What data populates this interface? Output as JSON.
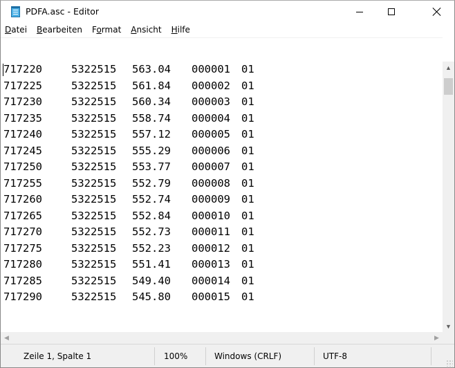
{
  "window": {
    "title": "PDFA.asc - Editor"
  },
  "menu": [
    "Datei",
    "Bearbeiten",
    "Format",
    "Ansicht",
    "Hilfe"
  ],
  "menu_mnemonics": [
    "D",
    "B",
    "o",
    "A",
    "H"
  ],
  "document": {
    "lines": [
      [
        "717220",
        "5322515",
        "563.04",
        "000001",
        "01"
      ],
      [
        "717225",
        "5322515",
        "561.84",
        "000002",
        "01"
      ],
      [
        "717230",
        "5322515",
        "560.34",
        "000003",
        "01"
      ],
      [
        "717235",
        "5322515",
        "558.74",
        "000004",
        "01"
      ],
      [
        "717240",
        "5322515",
        "557.12",
        "000005",
        "01"
      ],
      [
        "717245",
        "5322515",
        "555.29",
        "000006",
        "01"
      ],
      [
        "717250",
        "5322515",
        "553.77",
        "000007",
        "01"
      ],
      [
        "717255",
        "5322515",
        "552.79",
        "000008",
        "01"
      ],
      [
        "717260",
        "5322515",
        "552.74",
        "000009",
        "01"
      ],
      [
        "717265",
        "5322515",
        "552.84",
        "000010",
        "01"
      ],
      [
        "717270",
        "5322515",
        "552.73",
        "000011",
        "01"
      ],
      [
        "717275",
        "5322515",
        "552.23",
        "000012",
        "01"
      ],
      [
        "717280",
        "5322515",
        "551.41",
        "000013",
        "01"
      ],
      [
        "717285",
        "5322515",
        "549.40",
        "000014",
        "01"
      ],
      [
        "717290",
        "5322515",
        "545.80",
        "000015",
        "01"
      ]
    ]
  },
  "status": {
    "position": "Zeile 1, Spalte 1",
    "zoom": "100%",
    "line_ending": "Windows (CRLF)",
    "encoding": "UTF-8"
  },
  "icons": {
    "app": "notepad-icon",
    "minimize": "minimize-icon",
    "maximize": "maximize-icon",
    "close": "close-icon",
    "scroll_up": "chevron-up-icon",
    "scroll_down": "chevron-down-icon",
    "scroll_left": "chevron-left-icon",
    "scroll_right": "chevron-right-icon"
  }
}
